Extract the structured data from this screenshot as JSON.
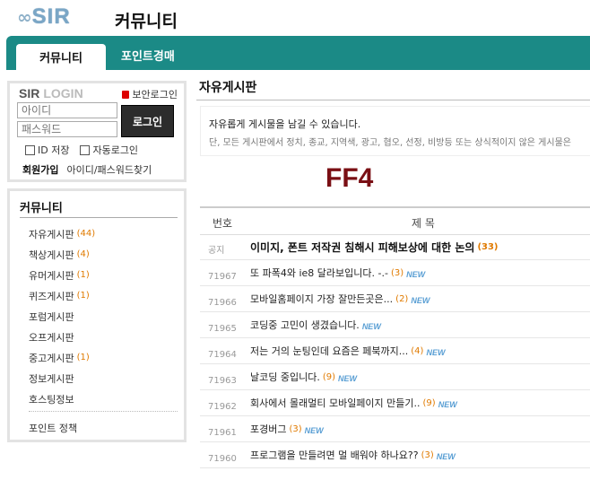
{
  "header": {
    "logo_symbol": "∞",
    "logo_text": "SIR",
    "title": "커뮤니티"
  },
  "nav": {
    "active_tab": "커뮤니티",
    "tab2": "포인트경매"
  },
  "login": {
    "brand": "SIR",
    "label": "LOGIN",
    "secure_login": "보안로그인",
    "id_placeholder": "아이디",
    "pw_placeholder": "패스워드",
    "login_button": "로그인",
    "save_id": "ID 저장",
    "auto_login": "자동로그인",
    "join": "회원가입",
    "find": "아이디/패스워드찾기"
  },
  "sidebar": {
    "title": "커뮤니티",
    "items": [
      {
        "label": "자유게시판",
        "count": "(44)"
      },
      {
        "label": "책상게시판",
        "count": "(4)"
      },
      {
        "label": "유머게시판",
        "count": "(1)"
      },
      {
        "label": "퀴즈게시판",
        "count": "(1)"
      },
      {
        "label": "포럼게시판",
        "count": ""
      },
      {
        "label": "오프게시판",
        "count": ""
      },
      {
        "label": "중고게시판",
        "count": "(1)"
      },
      {
        "label": "정보게시판",
        "count": ""
      },
      {
        "label": "호스팅정보",
        "count": ""
      }
    ],
    "point_policy": "포인트 정책"
  },
  "main": {
    "title": "자유게시판",
    "desc1": "자유롭게 게시물을 남길 수 있습니다.",
    "desc2": "단, 모든 게시판에서 정치, 종교, 지역색, 광고, 협오, 선정, 비방등 또는 상식적이지 않은 게시물은",
    "banner": "FF4",
    "col_num": "번호",
    "col_subject": "제  목",
    "new_label": "NEW",
    "rows": [
      {
        "num": "공지",
        "subject": "이미지, 폰트 저작권 침해시 피해보상에 대한 논의",
        "comments": "(33)",
        "new": false,
        "notice": true
      },
      {
        "num": "71967",
        "subject": "또 파폭4와 ie8 달라보입니다. -.-",
        "comments": "(3)",
        "new": true,
        "notice": false
      },
      {
        "num": "71966",
        "subject": "모바일홈페이지 가장 잘만든곳은...",
        "comments": "(2)",
        "new": true,
        "notice": false
      },
      {
        "num": "71965",
        "subject": "코딩중 고민이 생겼습니다.",
        "comments": "",
        "new": true,
        "notice": false
      },
      {
        "num": "71964",
        "subject": "저는 거의 눈팅인데 요즘은 페북까지...",
        "comments": "(4)",
        "new": true,
        "notice": false
      },
      {
        "num": "71963",
        "subject": "날코딩 중입니다.",
        "comments": "(9)",
        "new": true,
        "notice": false
      },
      {
        "num": "71962",
        "subject": "회사에서 몰래멀티 모바일페이지 만들기..",
        "comments": "(9)",
        "new": true,
        "notice": false
      },
      {
        "num": "71961",
        "subject": "포경버그",
        "comments": "(3)",
        "new": true,
        "notice": false
      },
      {
        "num": "71960",
        "subject": "프로그램을 만들려면 멀 배워야 하나요??",
        "comments": "(3)",
        "new": true,
        "notice": false
      }
    ]
  }
}
